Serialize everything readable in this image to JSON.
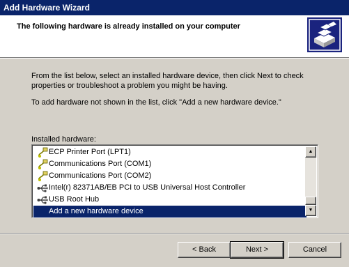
{
  "window": {
    "title": "Add Hardware Wizard"
  },
  "header": {
    "title": "The following hardware is already installed on your computer",
    "icon": "hardware-wizard-icon"
  },
  "body": {
    "description1": "From the list below, select an installed hardware device, then click Next to check properties or troubleshoot a problem you might be having.",
    "description2": "To add hardware not shown in the list, click \"Add a new hardware device.\"",
    "list_label": "Installed hardware:"
  },
  "list": {
    "items": [
      {
        "label": "ECP Printer Port (LPT1)",
        "icon": "port-icon"
      },
      {
        "label": "Communications Port (COM1)",
        "icon": "port-icon"
      },
      {
        "label": "Communications Port (COM2)",
        "icon": "port-icon"
      },
      {
        "label": "Intel(r) 82371AB/EB PCI to USB Universal Host Controller",
        "icon": "usb-icon"
      },
      {
        "label": "USB Root Hub",
        "icon": "usb-icon"
      },
      {
        "label": "Add a new hardware device",
        "icon": ""
      }
    ],
    "selected_index": 5
  },
  "buttons": {
    "back": "< Back",
    "next": "Next >",
    "cancel": "Cancel"
  },
  "colors": {
    "titlebar": "#0a246a",
    "selection": "#0a246a",
    "face": "#d4d0c8"
  }
}
